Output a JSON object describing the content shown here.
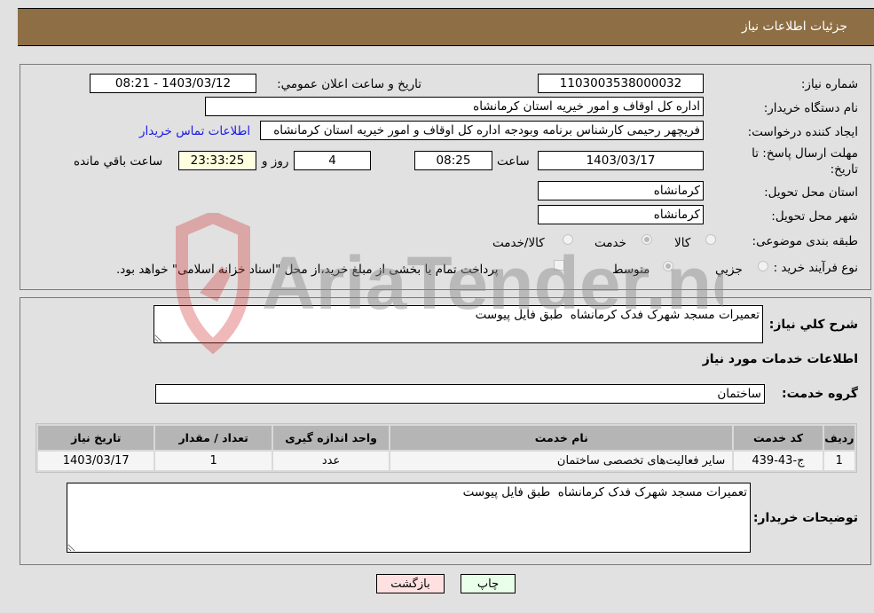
{
  "header": {
    "title": "جزئیات اطلاعات نیاز"
  },
  "form": {
    "need_number_label": "شماره نیاز:",
    "need_number": "1103003538000032",
    "announce_label": "تاریخ و ساعت اعلان عمومي:",
    "announce_value": "1403/03/12 - 08:21",
    "buyer_org_label": "نام دستگاه خریدار:",
    "buyer_org": "اداره کل اوقاف و امور خیریه استان کرمانشاه",
    "creator_label": "ایجاد کننده درخواست:",
    "creator": "فریچهر رحیمی کارشناس برنامه وبودجه اداره کل اوقاف و امور خیریه استان کرمانشاه",
    "contact_link": "اطلاعات تماس خریدار",
    "deadline_label": "مهلت ارسال پاسخ: تا تاریخ:",
    "deadline_date": "1403/03/17",
    "time_label": "ساعت",
    "deadline_time": "08:25",
    "days_value": "4",
    "days_label": "روز و",
    "remaining_time": "23:33:25",
    "remaining_label": "ساعت باقي مانده",
    "province_label": "استان محل تحویل:",
    "province": "کرمانشاه",
    "city_label": "شهر محل تحویل:",
    "city": "کرمانشاه",
    "category_label": "طبقه بندی موضوعی:",
    "category_options": [
      {
        "label": "کالا",
        "checked": false
      },
      {
        "label": "خدمت",
        "checked": true
      },
      {
        "label": "کالا/خدمت",
        "checked": false
      }
    ],
    "process_label": "نوع فرآیند خرید :",
    "process_options": [
      {
        "label": "جزیي",
        "checked": false
      },
      {
        "label": "متوسط",
        "checked": true
      }
    ],
    "payment_note": "پرداخت تمام یا بخشی از مبلغ خرید،از محل \"اسناد خزانه اسلامی\" خواهد بود."
  },
  "details": {
    "summary_label": "شرح كلي نياز:",
    "summary": "تعمیرات مسجد شهرک فدک کرمانشاه  طبق فایل پیوست",
    "services_title": "اطلاعات خدمات مورد نیاز",
    "service_group_label": "گروه خدمت:",
    "service_group": "ساختمان",
    "table": {
      "headers": [
        "ردیف",
        "کد خدمت",
        "نام خدمت",
        "واحد اندازه گیری",
        "تعداد / مقدار",
        "تاریخ نیاز"
      ],
      "rows": [
        [
          "1",
          "ج-43-439",
          "سایر فعالیت‌های تخصصی ساختمان",
          "عدد",
          "1",
          "1403/03/17"
        ]
      ]
    },
    "buyer_notes_label": "توضیحات خریدار:",
    "buyer_notes": "تعمیرات مسجد شهرک فدک کرمانشاه  طبق فایل پیوست"
  },
  "buttons": {
    "print": "چاپ",
    "back": "بازگشت"
  },
  "watermark": {
    "text": "AriaTender.neT"
  },
  "colors": {
    "header_bg": "#8e6e44",
    "print_bg": "#eaffea",
    "back_bg": "#ffe0e0",
    "link": "#1a1ae6"
  }
}
